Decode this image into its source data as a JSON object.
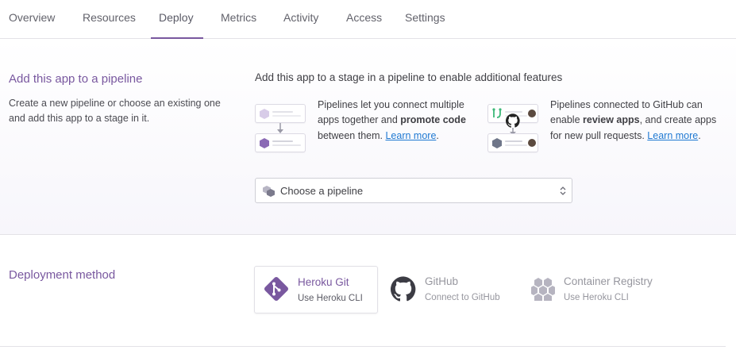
{
  "tabs": [
    {
      "label": "Overview"
    },
    {
      "label": "Resources"
    },
    {
      "label": "Deploy"
    },
    {
      "label": "Metrics"
    },
    {
      "label": "Activity"
    },
    {
      "label": "Access"
    },
    {
      "label": "Settings"
    }
  ],
  "active_tab": "Deploy",
  "pipeline": {
    "title": "Add this app to a pipeline",
    "description": "Create a new pipeline or choose an existing one and add this app to a stage in it.",
    "lead": "Add this app to a stage in a pipeline to enable additional features",
    "feature1": {
      "pre": "Pipelines let you connect multiple apps together and ",
      "bold": "promote code",
      "post": " between them. ",
      "link": "Learn more",
      "end": "."
    },
    "feature2": {
      "pre": "Pipelines connected to GitHub can enable ",
      "bold": "review apps",
      "post": ", and create apps for new pull requests. ",
      "link": "Learn more",
      "end": "."
    },
    "select_value": "Choose a pipeline"
  },
  "deploy": {
    "title": "Deployment method",
    "methods": [
      {
        "title": "Heroku Git",
        "subtitle": "Use Heroku CLI",
        "icon": "git-icon",
        "selected": true
      },
      {
        "title": "GitHub",
        "subtitle": "Connect to GitHub",
        "icon": "github-icon",
        "selected": false
      },
      {
        "title": "Container Registry",
        "subtitle": "Use Heroku CLI",
        "icon": "container-registry-icon",
        "selected": false
      }
    ]
  },
  "colors": {
    "accent": "#79589f",
    "link": "#1f79d2",
    "muted": "#96969e"
  }
}
